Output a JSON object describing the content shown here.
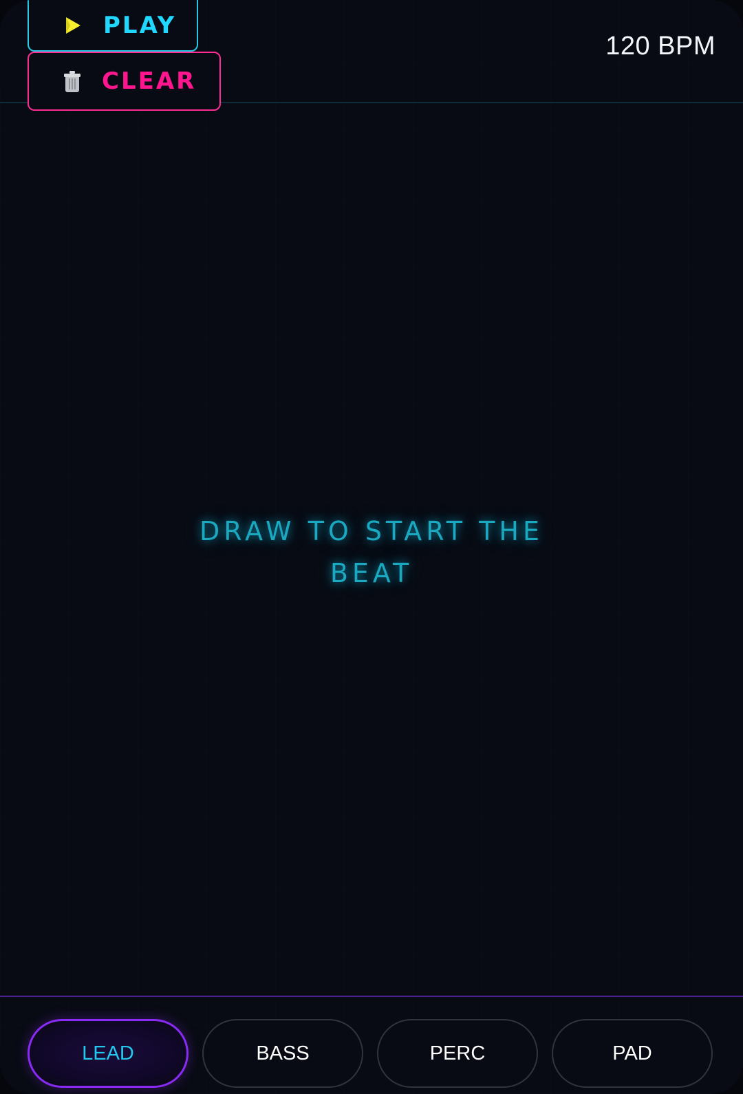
{
  "header": {
    "play_label": "PLAY",
    "clear_label": "CLEAR",
    "bpm_text": "120 BPM"
  },
  "canvas": {
    "hint_line1": "DRAW TO START THE",
    "hint_line2": "BEAT"
  },
  "footer": {
    "tabs": [
      {
        "label": "LEAD",
        "active": true
      },
      {
        "label": "BASS",
        "active": false
      },
      {
        "label": "PERC",
        "active": false
      },
      {
        "label": "PAD",
        "active": false
      }
    ]
  },
  "colors": {
    "background": "#080b13",
    "play_accent": "#20d7ff",
    "clear_accent": "#ff168f",
    "active_tab": "#8a2bf5",
    "active_tab_text": "#23c8ef"
  },
  "icons": {
    "play": "play-icon",
    "clear": "trash-icon"
  }
}
